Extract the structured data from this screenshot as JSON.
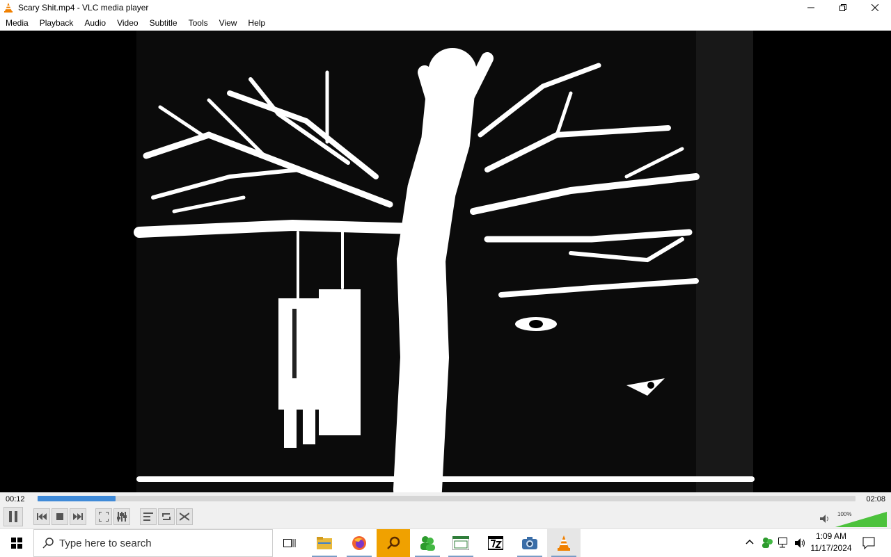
{
  "window": {
    "title": "Scary Shit.mp4 - VLC media player",
    "icon": "vlc-cone-icon"
  },
  "menu": [
    "Media",
    "Playback",
    "Audio",
    "Video",
    "Subtitle",
    "Tools",
    "View",
    "Help"
  ],
  "player": {
    "current_time": "00:12",
    "total_time": "02:08",
    "progress_fraction": 0.095,
    "volume_label": "100%",
    "volume_fraction": 1.0,
    "accent_color": "#3f8ad8"
  },
  "taskbar": {
    "search_placeholder": "Type here to search",
    "time": "1:09 AM",
    "date": "11/17/2024",
    "apps": [
      "task-view-icon",
      "file-explorer-icon",
      "firefox-icon",
      "search-app-icon",
      "people-app-icon",
      "sheet-app-icon",
      "7zip-icon",
      "camera-app-icon",
      "vlc-icon"
    ]
  }
}
